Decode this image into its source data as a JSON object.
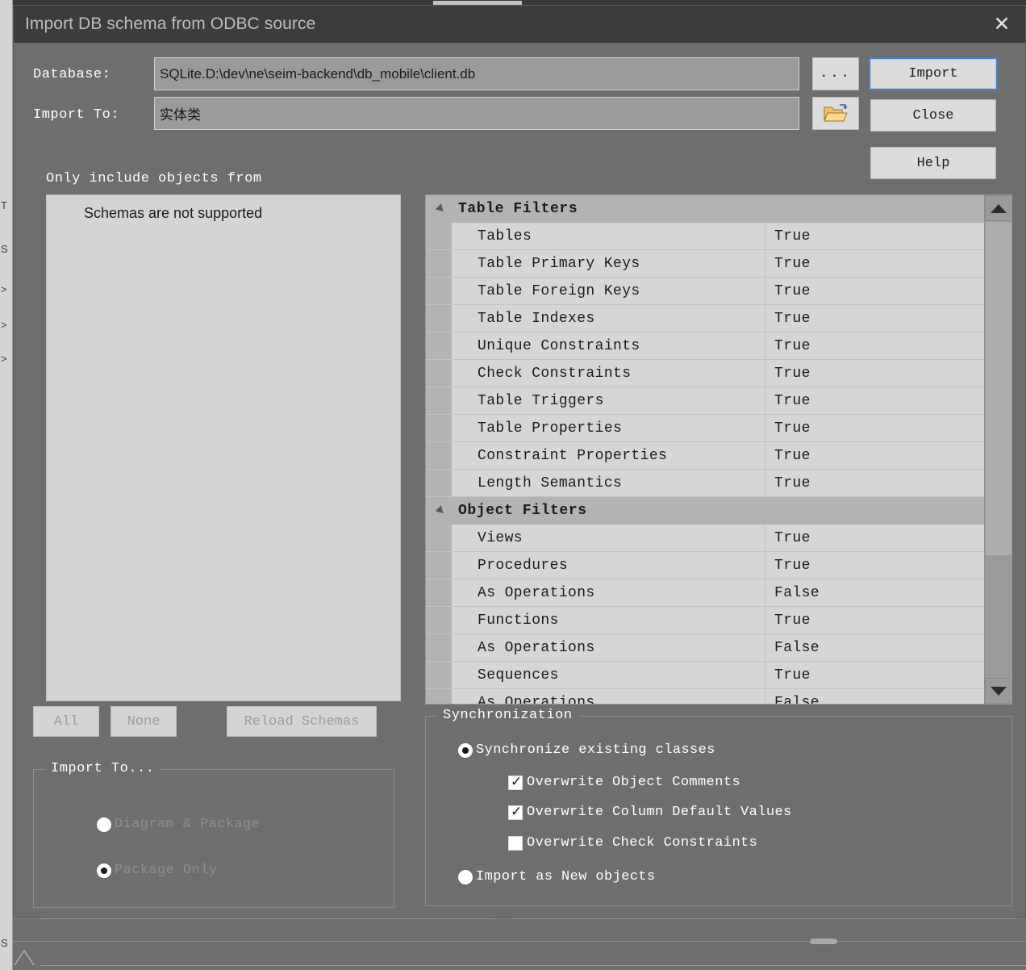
{
  "window": {
    "title": "Import DB schema from ODBC source",
    "close_icon": "close-icon"
  },
  "form": {
    "database_label": "Database:",
    "database_value": "SQLite.D:\\dev\\ne\\seim-backend\\db_mobile\\client.db",
    "database_placeholder": "",
    "browse_button_label": "...",
    "import_to_label": "Import To:",
    "import_to_value": "实体类",
    "import_to_placeholder": "",
    "folder_button_icon": "open-folder-icon"
  },
  "actions": {
    "import_label": "Import",
    "close_label": "Close",
    "help_label": "Help"
  },
  "schemas": {
    "section_label": "Only include objects from",
    "empty_message": "Schemas are not supported",
    "all_label": "All",
    "none_label": "None",
    "reload_label": "Reload Schemas"
  },
  "import_to_group": {
    "legend": "Import To...",
    "options": [
      {
        "label": "Diagram & Package",
        "selected": false,
        "disabled": true
      },
      {
        "label": "Package Only",
        "selected": true,
        "disabled": true
      }
    ]
  },
  "filters": {
    "groups": [
      {
        "name": "Table Filters",
        "expanded": true,
        "rows": [
          {
            "name": "Tables",
            "value": "True"
          },
          {
            "name": "Table Primary Keys",
            "value": "True"
          },
          {
            "name": "Table Foreign Keys",
            "value": "True"
          },
          {
            "name": "Table Indexes",
            "value": "True"
          },
          {
            "name": "Unique Constraints",
            "value": "True"
          },
          {
            "name": "Check Constraints",
            "value": "True"
          },
          {
            "name": "Table Triggers",
            "value": "True"
          },
          {
            "name": "Table Properties",
            "value": "True"
          },
          {
            "name": "Constraint Properties",
            "value": "True"
          },
          {
            "name": "Length Semantics",
            "value": "True"
          }
        ]
      },
      {
        "name": "Object Filters",
        "expanded": true,
        "rows": [
          {
            "name": "Views",
            "value": "True"
          },
          {
            "name": "Procedures",
            "value": "True"
          },
          {
            "name": "As Operations",
            "value": "False"
          },
          {
            "name": "Functions",
            "value": "True"
          },
          {
            "name": "As Operations",
            "value": "False"
          },
          {
            "name": "Sequences",
            "value": "True"
          },
          {
            "name": "As Operations",
            "value": "False"
          }
        ]
      }
    ],
    "scroll_up_icon": "triangle-up-icon",
    "scroll_down_icon": "triangle-down-icon"
  },
  "sync": {
    "legend": "Synchronization",
    "radios": [
      {
        "label": "Synchronize existing classes",
        "selected": true
      },
      {
        "label": "Import as New objects",
        "selected": false
      }
    ],
    "checkboxes": [
      {
        "label": "Overwrite Object Comments",
        "checked": true
      },
      {
        "label": "Overwrite Column Default Values",
        "checked": true
      },
      {
        "label": "Overwrite Check Constraints",
        "checked": false
      }
    ]
  },
  "colors": {
    "titlebar": "#3c3c3c",
    "dialog_bg": "#6e6e6e",
    "field_bg": "#9a9a9a",
    "grid_row": "#d6d6d6",
    "grid_group": "#b3b3b3",
    "focus_accent": "#3f7fd0"
  },
  "background_window": {
    "left_fragments": [
      "T",
      "S",
      ">",
      ">",
      ">",
      "S"
    ]
  }
}
